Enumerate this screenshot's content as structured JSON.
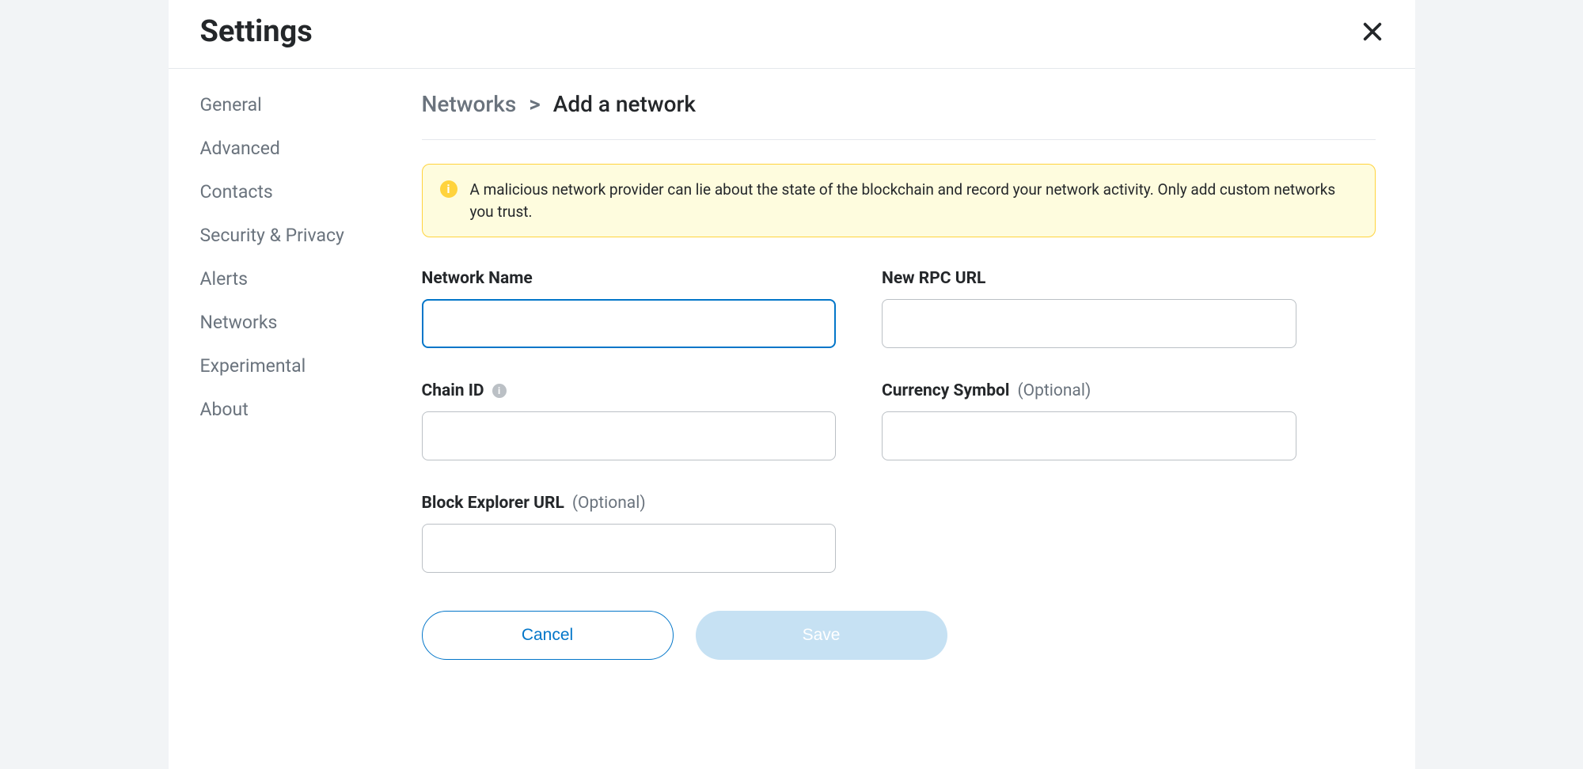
{
  "header": {
    "title": "Settings"
  },
  "sidebar": {
    "items": [
      {
        "label": "General"
      },
      {
        "label": "Advanced"
      },
      {
        "label": "Contacts"
      },
      {
        "label": "Security & Privacy"
      },
      {
        "label": "Alerts"
      },
      {
        "label": "Networks"
      },
      {
        "label": "Experimental"
      },
      {
        "label": "About"
      }
    ]
  },
  "breadcrumb": {
    "back": "Networks",
    "separator": ">",
    "current": "Add a network"
  },
  "warning": {
    "icon_glyph": "i",
    "text": "A malicious network provider can lie about the state of the blockchain and record your network activity. Only add custom networks you trust."
  },
  "form": {
    "network_name": {
      "label": "Network Name",
      "value": ""
    },
    "rpc_url": {
      "label": "New RPC URL",
      "value": ""
    },
    "chain_id": {
      "label": "Chain ID",
      "value": "",
      "info_glyph": "i"
    },
    "currency_symbol": {
      "label": "Currency Symbol",
      "optional": "(Optional)",
      "value": ""
    },
    "block_explorer": {
      "label": "Block Explorer URL",
      "optional": "(Optional)",
      "value": ""
    }
  },
  "buttons": {
    "cancel": "Cancel",
    "save": "Save"
  }
}
